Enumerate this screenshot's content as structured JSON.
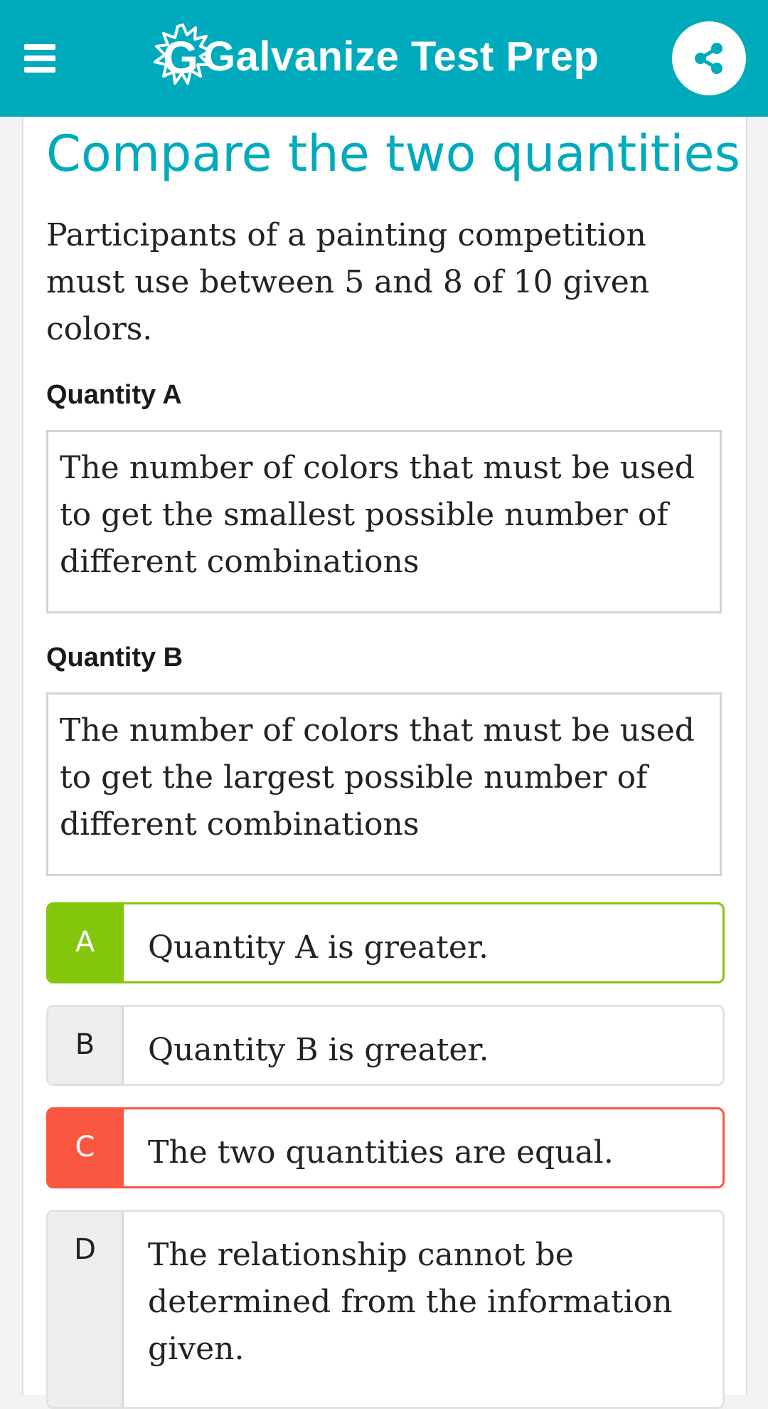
{
  "header": {
    "brand": "Galvanize Test Prep",
    "menu_icon": "hamburger-menu-icon",
    "share_icon": "share-icon",
    "logo_icon": "galvanize-starburst-logo",
    "background_color": "#00aabd"
  },
  "question": {
    "title": "Compare the two quantities",
    "prompt": "Participants of a painting competition must use between 5 and 8 of 10 given colors.",
    "quantity_a": {
      "label": "Quantity A",
      "text": "The number of colors that must be used to get the smallest possible number of different combinations"
    },
    "quantity_b": {
      "label": "Quantity B",
      "text": "The number of colors that must be used to get the largest possible number of different combinations"
    }
  },
  "options": [
    {
      "letter": "A",
      "text": "Quantity A is greater.",
      "state": "correct"
    },
    {
      "letter": "B",
      "text": "Quantity B is greater.",
      "state": "neutral"
    },
    {
      "letter": "C",
      "text": "The two quantities are equal.",
      "state": "incorrect"
    },
    {
      "letter": "D",
      "text": "The relationship cannot be determined from the information given.",
      "state": "neutral"
    }
  ],
  "colors": {
    "accent": "#00aabd",
    "correct": "#83c60b",
    "incorrect": "#fa5740"
  }
}
